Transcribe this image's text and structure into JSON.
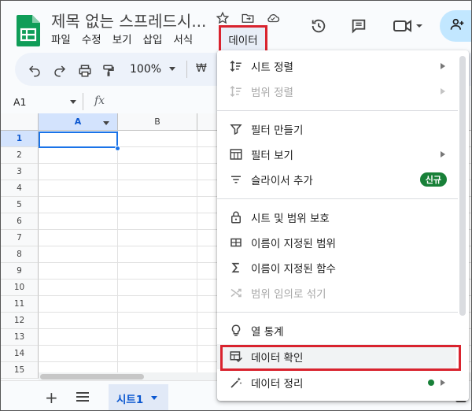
{
  "doc": {
    "title": "제목 없는 스프레드시..."
  },
  "menu_bar": {
    "items": [
      "파일",
      "수정",
      "보기",
      "삽입",
      "서식"
    ],
    "active": "데이터"
  },
  "header_icons": [
    "star-icon",
    "move-folder-icon",
    "cloud-saved-icon",
    "history-icon",
    "comment-icon",
    "meet-icon",
    "share-icon"
  ],
  "toolbar": {
    "zoom": "100%",
    "currency": "₩"
  },
  "formula_bar": {
    "cell_ref": "A1",
    "fx": "fx"
  },
  "grid": {
    "columns": [
      "A",
      "B"
    ],
    "rows": [
      "1",
      "2",
      "3",
      "4",
      "5",
      "6",
      "7",
      "8",
      "9",
      "10",
      "11",
      "12",
      "13",
      "14",
      "15"
    ],
    "selected_cell": "A1"
  },
  "sheets": {
    "add": "+",
    "tabs": [
      {
        "label": "시트1",
        "active": true
      }
    ]
  },
  "data_menu": {
    "items": [
      {
        "label": "시트 정렬",
        "icon": "sort-sheet-icon",
        "submenu": true,
        "disabled": false
      },
      {
        "label": "범위 정렬",
        "icon": "sort-range-icon",
        "submenu": true,
        "disabled": true
      },
      {
        "label": "필터 만들기",
        "icon": "filter-icon",
        "submenu": false,
        "disabled": false
      },
      {
        "label": "필터 보기",
        "icon": "filter-view-icon",
        "submenu": true,
        "disabled": false
      },
      {
        "label": "슬라이서 추가",
        "icon": "slicer-icon",
        "submenu": false,
        "disabled": false,
        "badge": "신규"
      },
      {
        "label": "시트 및 범위 보호",
        "icon": "lock-icon",
        "submenu": false,
        "disabled": false
      },
      {
        "label": "이름이 지정된 범위",
        "icon": "named-range-icon",
        "submenu": false,
        "disabled": false
      },
      {
        "label": "이름이 지정된 함수",
        "icon": "sigma-icon",
        "submenu": false,
        "disabled": false
      },
      {
        "label": "범위 임의로 섞기",
        "icon": "shuffle-icon",
        "submenu": false,
        "disabled": true
      },
      {
        "label": "열 통계",
        "icon": "lightbulb-icon",
        "submenu": false,
        "disabled": false
      },
      {
        "label": "데이터 확인",
        "icon": "data-validation-icon",
        "submenu": false,
        "disabled": false,
        "highlighted": true
      },
      {
        "label": "데이터 정리",
        "icon": "data-cleanup-icon",
        "submenu": true,
        "disabled": false,
        "dot": true
      }
    ]
  },
  "colors": {
    "highlight_box": "#d9232e",
    "accent": "#1a73e8",
    "badge": "#188038",
    "share_button": "#c2e7ff"
  }
}
